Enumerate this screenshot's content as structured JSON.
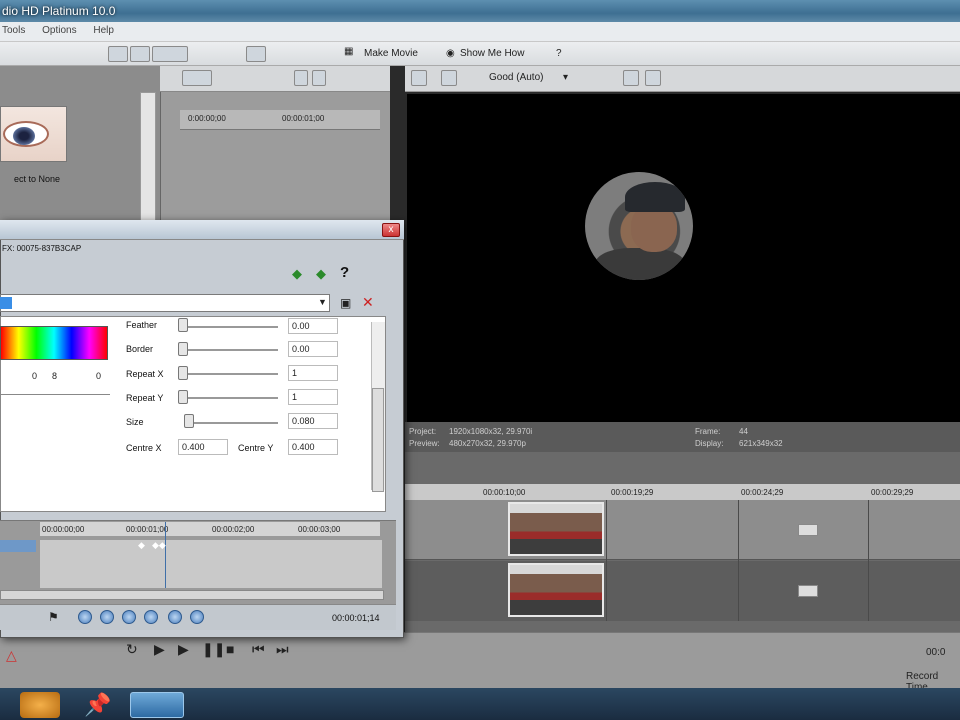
{
  "window": {
    "title": "dio HD Platinum 10.0"
  },
  "menu": [
    "Tools",
    "Options",
    "Help"
  ],
  "toolbar": {
    "make_movie": "Make Movie",
    "show_me_how": "Show Me How"
  },
  "media_panel": {
    "item_label": "ect to None"
  },
  "trimmer": {
    "ruler_start": "0:00:00;00",
    "ruler_mid": "00:00:01;00"
  },
  "preview_toolbar": {
    "quality": "Good (Auto)"
  },
  "preview_info": {
    "project_label": "Project:",
    "project_value": "1920x1080x32, 29.970i",
    "preview_label": "Preview:",
    "preview_value": "480x270x32, 29.970p",
    "frame_label": "Frame:",
    "frame_value": "44",
    "display_label": "Display:",
    "display_value": "621x349x32"
  },
  "timeline": {
    "ticks": [
      "00:00:10;00",
      "00:00:19;29",
      "00:00:24;29",
      "00:00:29;29"
    ]
  },
  "dialog": {
    "fx_text": "FX: 00075-837B3CAP",
    "help": "?",
    "close": "x",
    "color_vals": [
      "0",
      "8",
      "0"
    ],
    "props": [
      {
        "label": "Feather",
        "value": "0.00"
      },
      {
        "label": "Border",
        "value": "0.00"
      },
      {
        "label": "Repeat X",
        "value": "1"
      },
      {
        "label": "Repeat Y",
        "value": "1"
      },
      {
        "label": "Size",
        "value": "0.080"
      }
    ],
    "centre_x_label": "Centre X",
    "centre_x_value": "0.400",
    "centre_y_label": "Centre Y",
    "centre_y_value": "0.400",
    "kf_ticks": [
      "00:00:00;00",
      "00:00:01;00",
      "00:00:02;00",
      "00:00:03;00"
    ],
    "kf_time": "00:00:01;14"
  },
  "status": {
    "record_time": "Record Time",
    "time_right": "00:0"
  },
  "colors": {
    "preview_bg": "#000000",
    "selection": "#3a8ee6"
  }
}
